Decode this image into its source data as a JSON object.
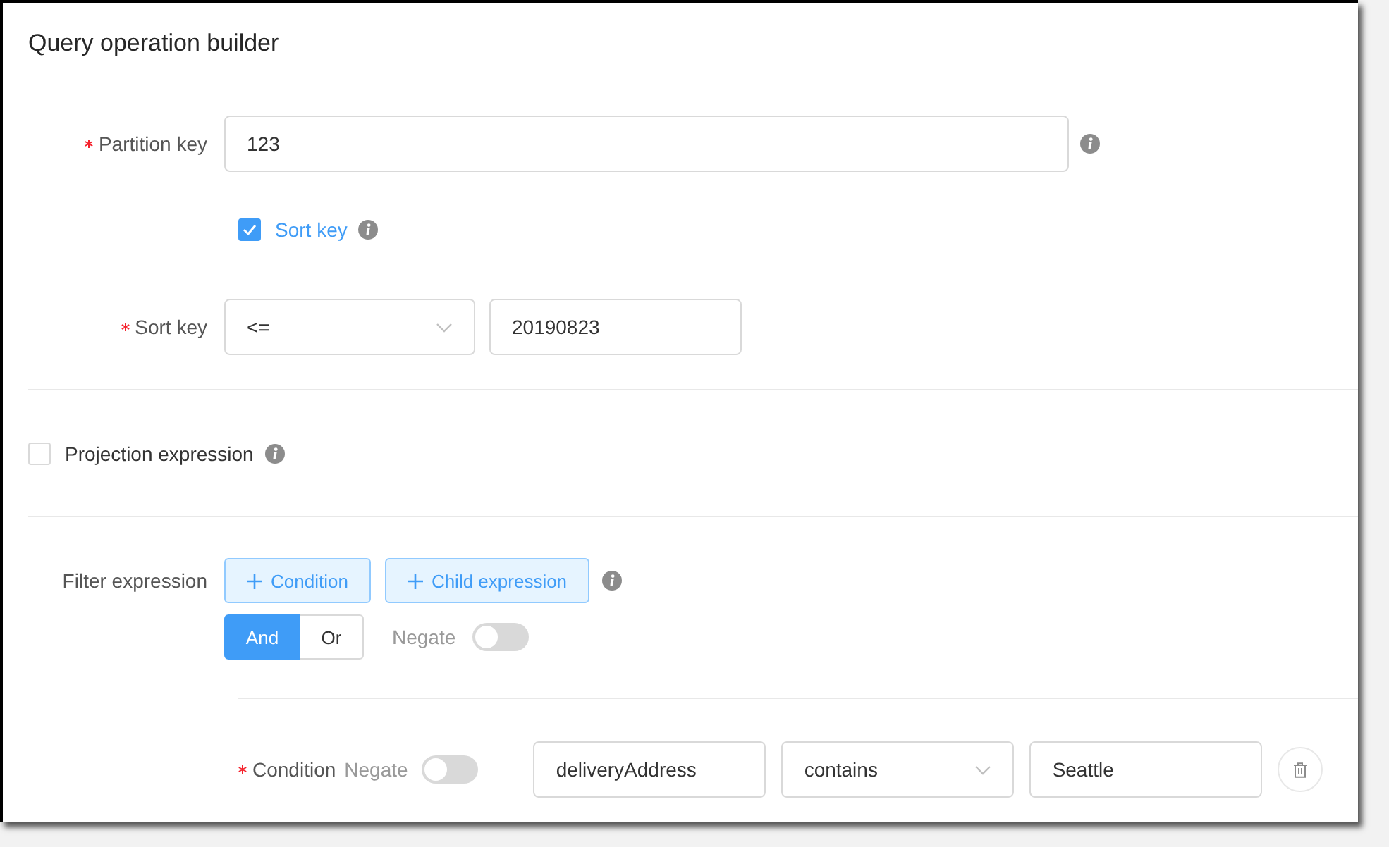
{
  "title": "Query operation builder",
  "partition_key": {
    "label": "Partition key",
    "required": true,
    "value": "123"
  },
  "sort_key_toggle": {
    "label": "Sort key",
    "checked": true
  },
  "sort_key": {
    "label": "Sort key",
    "required": true,
    "operator": "<=",
    "value": "20190823"
  },
  "projection": {
    "label": "Projection expression",
    "checked": false
  },
  "filter": {
    "label": "Filter expression",
    "buttons": [
      "Condition",
      "Child expression"
    ],
    "logic": [
      {
        "label": "And",
        "selected": true
      },
      {
        "label": "Or",
        "selected": false
      }
    ],
    "negate_label": "Negate",
    "negate": false
  },
  "conditions": [
    {
      "label": "Condition",
      "required": true,
      "negate_label": "Negate",
      "negate": false,
      "attribute": "deliveryAddress",
      "operator": "contains",
      "value": "Seattle"
    }
  ]
}
